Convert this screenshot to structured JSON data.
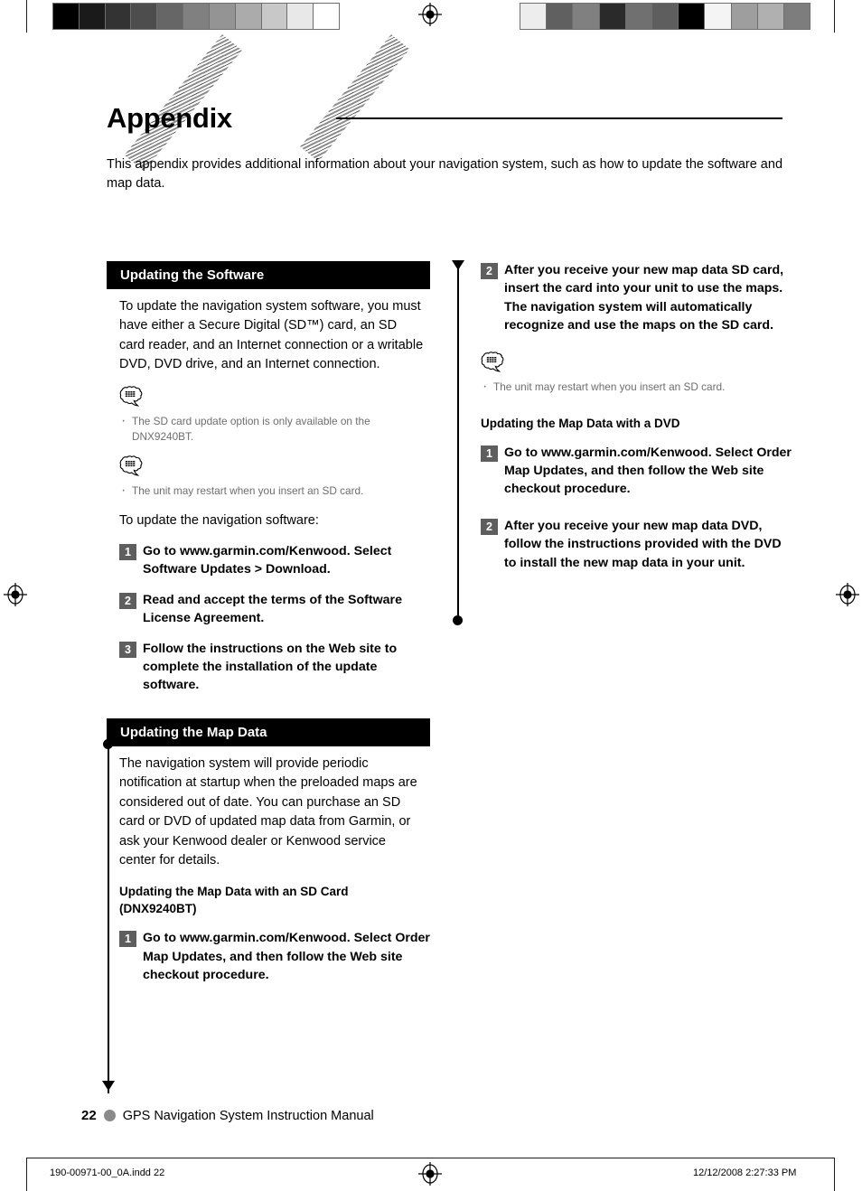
{
  "page": {
    "title": "Appendix",
    "intro": "This appendix provides additional information about your navigation system, such as how to update the software and map data.",
    "footer_page_number": "22",
    "footer_title": "GPS Navigation System Instruction Manual",
    "print_file": "190-00971-00_0A.indd   22",
    "print_timestamp": "12/12/2008   2:27:33 PM"
  },
  "left_column": {
    "section1": {
      "heading": "Updating the Software",
      "paragraph": "To update the navigation system software, you must have either a Secure Digital (SD™) card, an SD card reader, and an Internet connection or a writable DVD, DVD drive, and an Internet connection.",
      "note1": {
        "icon": "note-bubble-icon",
        "items": [
          "The SD card update option is only available on the DNX9240BT."
        ]
      },
      "note2": {
        "icon": "note-bubble-icon",
        "items": [
          "The unit may restart when you insert an SD card."
        ]
      },
      "lead_in": "To update the navigation software:",
      "steps": [
        {
          "num": "1",
          "text": "Go to www.garmin.com/Kenwood. Select Software Updates > Download."
        },
        {
          "num": "2",
          "text": "Read and accept the terms of the Software License Agreement."
        },
        {
          "num": "3",
          "text": "Follow the instructions on the Web site to complete the installation of the update software."
        }
      ]
    },
    "section2": {
      "heading": "Updating the Map Data",
      "paragraph": "The navigation system will provide periodic notification at startup when the preloaded maps are considered out of date. You can purchase an SD card or DVD of updated map data from Garmin, or ask your Kenwood dealer or Kenwood service center for details.",
      "subheading": "Updating the Map Data with an SD Card (DNX9240BT)",
      "steps": [
        {
          "num": "1",
          "text": "Go to www.garmin.com/Kenwood. Select Order Map Updates, and then follow the Web site checkout procedure."
        }
      ]
    }
  },
  "right_column": {
    "continued_steps": [
      {
        "num": "2",
        "text": "After you receive your new map data SD card, insert the card into your unit to use the maps. The navigation system will automatically recognize and use the maps on the SD card."
      }
    ],
    "note": {
      "icon": "note-bubble-icon",
      "items": [
        "The unit may restart when you insert an SD card."
      ]
    },
    "subheading": "Updating the Map Data with a DVD",
    "steps": [
      {
        "num": "1",
        "text": "Go to www.garmin.com/Kenwood. Select Order Map Updates, and then follow the Web site checkout procedure."
      },
      {
        "num": "2",
        "text": "After you receive your new map data DVD, follow the instructions provided with the DVD to install the new map data in your unit."
      }
    ]
  },
  "print_marks": {
    "calibration_left": [
      "#000000",
      "#1a1a1a",
      "#333333",
      "#4d4d4d",
      "#666666",
      "#808080",
      "#949494",
      "#ababab",
      "#c8c8c8",
      "#e8e8e8",
      "#ffffff"
    ],
    "calibration_right": [
      "#ededed",
      "#606060",
      "#808080",
      "#2a2a2a",
      "#707070",
      "#5e5e5e",
      "#000000",
      "#f4f4f4",
      "#9e9e9e",
      "#b0b0b0",
      "#7d7d7d"
    ],
    "registration_icon": "registration-target-icon"
  },
  "colors": {
    "section_header_bg": "#000000",
    "section_header_fg": "#ffffff",
    "step_badge_bg": "#5e5e5e",
    "note_text": "#6e6e6e",
    "footer_dot": "#8a8a8a"
  }
}
